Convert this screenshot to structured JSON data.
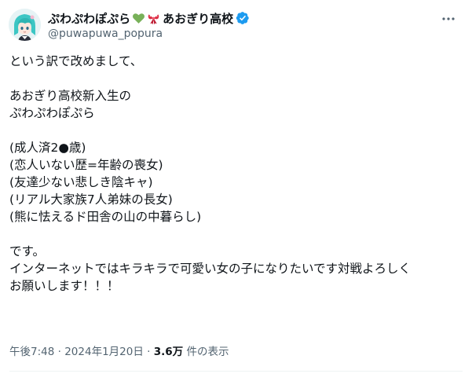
{
  "author": {
    "display_name": "ぷわぷわぽぷら",
    "school": "あおぎり高校",
    "handle": "@puwapuwa_popura",
    "emojis": [
      "green-heart-icon",
      "ribbon-icon"
    ],
    "verified": true
  },
  "tweet": {
    "lines": [
      "という訳で改めまして、",
      "",
      "あおぎり高校新入生の",
      "ぷわぷわぽぷら",
      "",
      "(成人済2●歳)",
      "(恋人いない歴=年齢の喪女)",
      "(友達少ない悲しき陰キャ)",
      "(リアル大家族7人弟妹の長女)",
      "(熊に怯えるド田舎の山の中暮らし)",
      "",
      "です。",
      "インターネットではキラキラで可愛い女の子になりたいです対戦よろしく",
      "お願いします！！！"
    ]
  },
  "meta": {
    "time": "午後7:48",
    "separator": "·",
    "date": "2024年1月20日",
    "views_count": "3.6万",
    "views_label": "件の表示"
  },
  "colors": {
    "text": "#0f1419",
    "secondary": "#536471",
    "verified": "#1d9bf0",
    "heart": "#78b159"
  }
}
